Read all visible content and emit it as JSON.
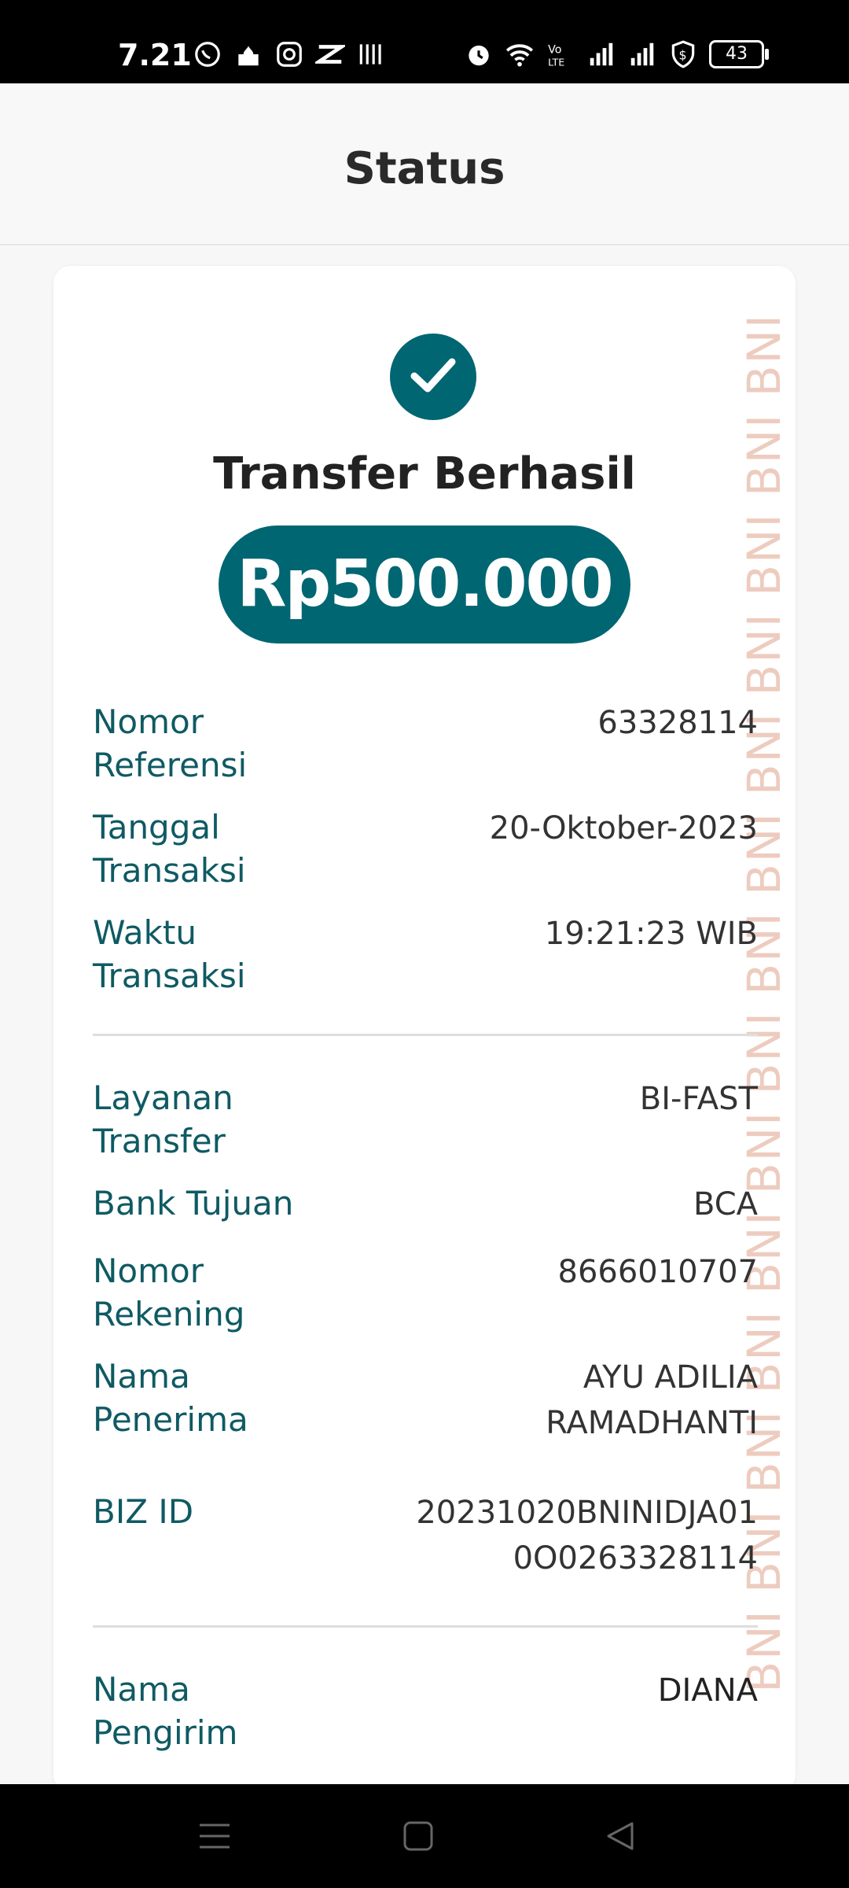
{
  "status_bar": {
    "time": "7.21",
    "battery": "43",
    "icons_left": [
      "whatsapp-icon",
      "mosque-icon",
      "instagram-icon",
      "capcut-icon",
      "bni-icon"
    ],
    "icons_right": [
      "alarm-icon",
      "wifi-icon",
      "volte-icon",
      "signal-icon",
      "signal-icon",
      "vpn-shield-icon"
    ]
  },
  "header": {
    "title": "Status"
  },
  "receipt": {
    "status_title": "Transfer Berhasil",
    "amount": "Rp500.000",
    "watermark": "BNI BNI BNI BNI BNI BNI BNI BNI BNI BNI BNI BNI BNI BNI",
    "rows": [
      {
        "label": "Nomor Referensi",
        "value": "63328114"
      },
      {
        "label": "Tanggal Transaksi",
        "value": "20-Oktober-2023"
      },
      {
        "label": "Waktu Transaksi",
        "value": "19:21:23 WIB"
      },
      {
        "label": "Layanan Transfer",
        "value": "BI-FAST"
      },
      {
        "label": "Bank Tujuan",
        "value": "BCA"
      },
      {
        "label": "Nomor Rekening",
        "value": "8666010707"
      },
      {
        "label": "Nama Penerima",
        "value": "AYU ADILIA RAMADHANTI"
      },
      {
        "label": "BIZ ID",
        "value": "20231020BNINIDJA010O0263328114"
      },
      {
        "label": "Nama Pengirim",
        "value": "DIANA"
      }
    ]
  },
  "colors": {
    "primary": "#006672",
    "label": "#0f5a63"
  }
}
